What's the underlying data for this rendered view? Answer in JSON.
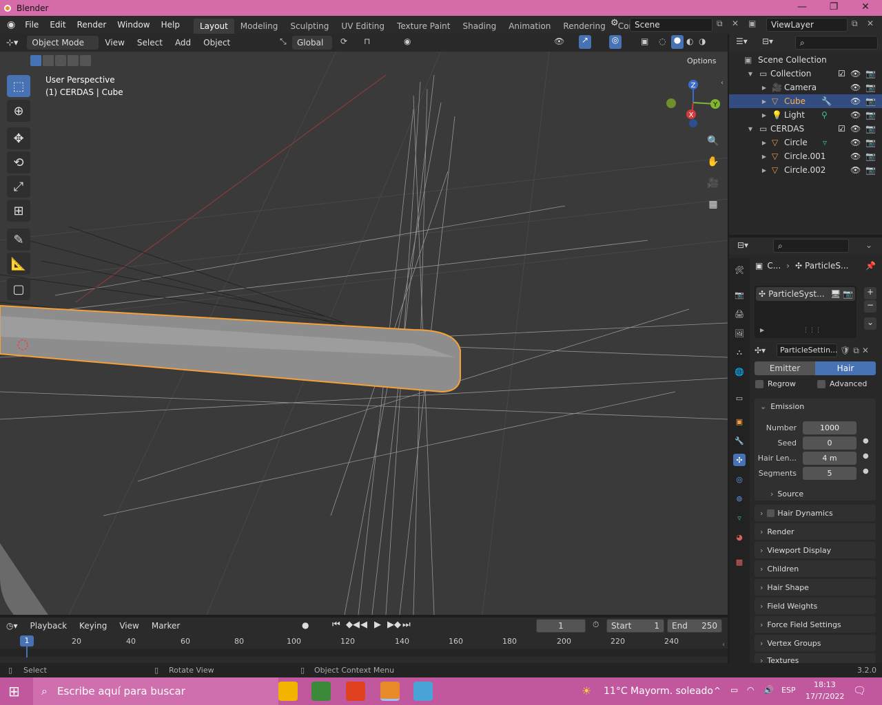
{
  "window": {
    "title": "Blender"
  },
  "menubar": {
    "items": [
      "File",
      "Edit",
      "Render",
      "Window",
      "Help"
    ]
  },
  "workspaces": [
    "Layout",
    "Modeling",
    "Sculpting",
    "UV Editing",
    "Texture Paint",
    "Shading",
    "Animation",
    "Rendering",
    "Compositing"
  ],
  "scene": {
    "name": "Scene",
    "view_layer": "ViewLayer"
  },
  "viewport_header": {
    "mode": "Object Mode",
    "menus": [
      "View",
      "Select",
      "Add",
      "Object"
    ],
    "orientation": "Global",
    "options": "Options"
  },
  "viewport": {
    "view_name": "User Perspective",
    "object_info": "(1) CERDAS | Cube",
    "gizmo": {
      "z": "Z",
      "y": "Y",
      "x": "X"
    }
  },
  "outliner": {
    "root": "Scene Collection",
    "rows": [
      {
        "label": "Collection",
        "type": "collection"
      },
      {
        "label": "Camera",
        "type": "camera"
      },
      {
        "label": "Cube",
        "type": "mesh",
        "selected": true
      },
      {
        "label": "Light",
        "type": "light"
      },
      {
        "label": "CERDAS",
        "type": "collection"
      },
      {
        "label": "Circle",
        "type": "mesh"
      },
      {
        "label": "Circle.001",
        "type": "mesh"
      },
      {
        "label": "Circle.002",
        "type": "mesh"
      }
    ]
  },
  "properties": {
    "breadcrumb": {
      "object": "C...",
      "item": "ParticleS..."
    },
    "particle_system": "ParticleSyst...",
    "settings": "ParticleSettin...",
    "type_tabs": {
      "emitter": "Emitter",
      "hair": "Hair",
      "active": "Hair"
    },
    "checkboxes": {
      "regrow": "Regrow",
      "advanced": "Advanced"
    },
    "emission": {
      "title": "Emission",
      "number_label": "Number",
      "number": "1000",
      "seed_label": "Seed",
      "seed": "0",
      "hair_len_label": "Hair Len...",
      "hair_len": "4 m",
      "segments_label": "Segments",
      "segments": "5",
      "source": "Source"
    },
    "panels": [
      "Hair Dynamics",
      "Render",
      "Viewport Display",
      "Children",
      "Hair Shape",
      "Field Weights",
      "Force Field Settings",
      "Vertex Groups",
      "Textures"
    ]
  },
  "timeline": {
    "menus": [
      "Playback",
      "Keying",
      "View",
      "Marker"
    ],
    "current_frame": "1",
    "start_label": "Start",
    "start": "1",
    "end_label": "End",
    "end": "250",
    "ruler_marks": [
      "20",
      "40",
      "60",
      "80",
      "100",
      "120",
      "140",
      "160",
      "180",
      "200",
      "220",
      "240"
    ],
    "playhead": "1"
  },
  "statusbar": {
    "select": "Select",
    "rotate": "Rotate View",
    "context": "Object Context Menu",
    "version": "3.2.0"
  },
  "taskbar": {
    "search_placeholder": "Escribe aquí para buscar",
    "weather": "11°C  Mayorm. soleado",
    "lang": "ESP",
    "time": "18:13",
    "date": "17/7/2022"
  },
  "colors": {
    "accent": "#4772b3",
    "selection_outline": "#f5a13a",
    "title_bar": "#d56ba8",
    "taskbar": "#c1579c"
  }
}
